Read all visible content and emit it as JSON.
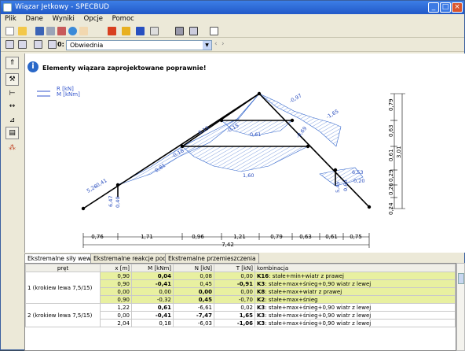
{
  "window": {
    "title": "Wiązar Jetkowy - SPECBUD"
  },
  "menu": [
    "Plik",
    "Dane",
    "Wyniki",
    "Opcje",
    "Pomoc"
  ],
  "toolbar2": {
    "index_label": "0:",
    "combo_value": "Obwiednia"
  },
  "info": {
    "message": "Elementy wiązara zaprojektowane poprawnie!"
  },
  "legend": {
    "r": "R [kN]",
    "m": "M [kNm]"
  },
  "labels": {
    "v1": "1,60",
    "v2": "0,61",
    "v3": "0,81",
    "v4": "-0,69",
    "v5": "-0,97",
    "v6": "-1,65",
    "v7": "6,53",
    "v8": "0,20",
    "v9": "5,26",
    "v10": "-0,41",
    "v11": "6,47",
    "v12": "0,40",
    "v13": "0,15",
    "v14": "-0,18",
    "v15": "5,45",
    "v16": "0,60",
    "v17": "-0,15"
  },
  "dim": {
    "bottom": [
      "0,76",
      "1,71",
      "0,96",
      "1,21",
      "0,79",
      "0,63",
      "0,61",
      "0,75"
    ],
    "total": "7,42",
    "right": [
      "0,79",
      "0,63",
      "0,61",
      "0,29",
      "0,26",
      "0,24"
    ],
    "right_total": "3,01"
  },
  "tabs": [
    "Ekstremalne siły wewnętrzne",
    "Ekstremalne reakcje podporowe",
    "Ekstremalne przemieszczenia"
  ],
  "table": {
    "headers": [
      "pręt",
      "x [m]",
      "M [kNm]",
      "N [kN]",
      "T [kN]",
      "kombinacja"
    ],
    "groups": [
      {
        "member": "1 (krokiew lewa 7,5/15)",
        "rows": [
          {
            "x": "0,90",
            "M": "0,04",
            "N": "0,08",
            "T": "0,00",
            "kk": "K16",
            "k": ": stałe+min+wiatr z prawej"
          },
          {
            "x": "0,90",
            "M": "-0,41",
            "N": "0,45",
            "T": "-0,91",
            "kk": "K3",
            "k": ": stałe+max+śnieg+0,90 wiatr z lewej"
          },
          {
            "x": "0,00",
            "M": "0,00",
            "N": "0,00",
            "T": "0,00",
            "kk": "K8",
            "k": ": stałe+max+wiatr z prawej"
          },
          {
            "x": "0,90",
            "M": "-0,32",
            "N": "0,45",
            "T": "-0,70",
            "kk": "K2",
            "k": ": stałe+max+śnieg"
          }
        ]
      },
      {
        "member": "2 (krokiew lewa 7,5/15)",
        "rows": [
          {
            "x": "1,22",
            "M": "0,61",
            "N": "-6,61",
            "T": "0,02",
            "kk": "K3",
            "k": ": stałe+max+śnieg+0,90 wiatr z lewej"
          },
          {
            "x": "0,00",
            "M": "-0,41",
            "N": "-7,47",
            "T": "1,65",
            "kk": "K3",
            "k": ": stałe+max+śnieg+0,90 wiatr z lewej"
          },
          {
            "x": "2,04",
            "M": "0,18",
            "N": "-6,03",
            "T": "-1,06",
            "kk": "K3",
            "k": ": stałe+max+śnieg+0,90 wiatr z lewej"
          }
        ]
      }
    ]
  }
}
